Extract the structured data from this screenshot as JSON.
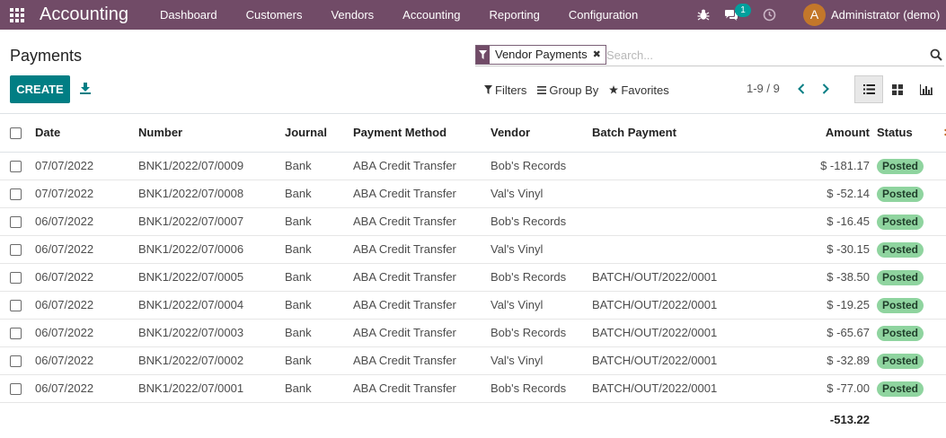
{
  "navbar": {
    "brand": "Accounting",
    "menu": [
      "Dashboard",
      "Customers",
      "Vendors",
      "Accounting",
      "Reporting",
      "Configuration"
    ],
    "messages_badge": "1",
    "avatar_letter": "A",
    "user_name": "Administrator (demo)"
  },
  "control_panel": {
    "title": "Payments",
    "create_label": "CREATE",
    "facet_label": "Vendor Payments",
    "facet_remove": "✖",
    "search_placeholder": "Search...",
    "filters_label": "Filters",
    "group_by_label": "Group By",
    "favorites_label": "Favorites",
    "pager": "1-9 / 9"
  },
  "table": {
    "columns": {
      "date": "Date",
      "number": "Number",
      "journal": "Journal",
      "method": "Payment Method",
      "vendor": "Vendor",
      "batch": "Batch Payment",
      "amount": "Amount",
      "status": "Status"
    },
    "rows": [
      {
        "date": "07/07/2022",
        "number": "BNK1/2022/07/0009",
        "journal": "Bank",
        "method": "ABA Credit Transfer",
        "vendor": "Bob's Records",
        "batch": "",
        "amount": "$ -181.17",
        "status": "Posted"
      },
      {
        "date": "07/07/2022",
        "number": "BNK1/2022/07/0008",
        "journal": "Bank",
        "method": "ABA Credit Transfer",
        "vendor": "Val's Vinyl",
        "batch": "",
        "amount": "$ -52.14",
        "status": "Posted"
      },
      {
        "date": "06/07/2022",
        "number": "BNK1/2022/07/0007",
        "journal": "Bank",
        "method": "ABA Credit Transfer",
        "vendor": "Bob's Records",
        "batch": "",
        "amount": "$ -16.45",
        "status": "Posted"
      },
      {
        "date": "06/07/2022",
        "number": "BNK1/2022/07/0006",
        "journal": "Bank",
        "method": "ABA Credit Transfer",
        "vendor": "Val's Vinyl",
        "batch": "",
        "amount": "$ -30.15",
        "status": "Posted"
      },
      {
        "date": "06/07/2022",
        "number": "BNK1/2022/07/0005",
        "journal": "Bank",
        "method": "ABA Credit Transfer",
        "vendor": "Bob's Records",
        "batch": "BATCH/OUT/2022/0001",
        "amount": "$ -38.50",
        "status": "Posted"
      },
      {
        "date": "06/07/2022",
        "number": "BNK1/2022/07/0004",
        "journal": "Bank",
        "method": "ABA Credit Transfer",
        "vendor": "Val's Vinyl",
        "batch": "BATCH/OUT/2022/0001",
        "amount": "$ -19.25",
        "status": "Posted"
      },
      {
        "date": "06/07/2022",
        "number": "BNK1/2022/07/0003",
        "journal": "Bank",
        "method": "ABA Credit Transfer",
        "vendor": "Bob's Records",
        "batch": "BATCH/OUT/2022/0001",
        "amount": "$ -65.67",
        "status": "Posted"
      },
      {
        "date": "06/07/2022",
        "number": "BNK1/2022/07/0002",
        "journal": "Bank",
        "method": "ABA Credit Transfer",
        "vendor": "Val's Vinyl",
        "batch": "BATCH/OUT/2022/0001",
        "amount": "$ -32.89",
        "status": "Posted"
      },
      {
        "date": "06/07/2022",
        "number": "BNK1/2022/07/0001",
        "journal": "Bank",
        "method": "ABA Credit Transfer",
        "vendor": "Bob's Records",
        "batch": "BATCH/OUT/2022/0001",
        "amount": "$ -77.00",
        "status": "Posted"
      }
    ],
    "total": "-513.22"
  },
  "colors": {
    "brand": "#714b67",
    "primary_button": "#017e84",
    "badge_bg": "#8fd49f",
    "messages_badge": "#00a09d",
    "avatar": "#c3772a",
    "pager_arrows": "#017e84"
  },
  "icons": [
    "apps-icon",
    "bug-icon",
    "chat-icon",
    "clock-icon",
    "download-icon",
    "filter-icon",
    "search-icon",
    "group-by-icon",
    "star-icon",
    "chevron-left-icon",
    "chevron-right-icon",
    "list-view-icon",
    "kanban-view-icon",
    "graph-view-icon"
  ]
}
